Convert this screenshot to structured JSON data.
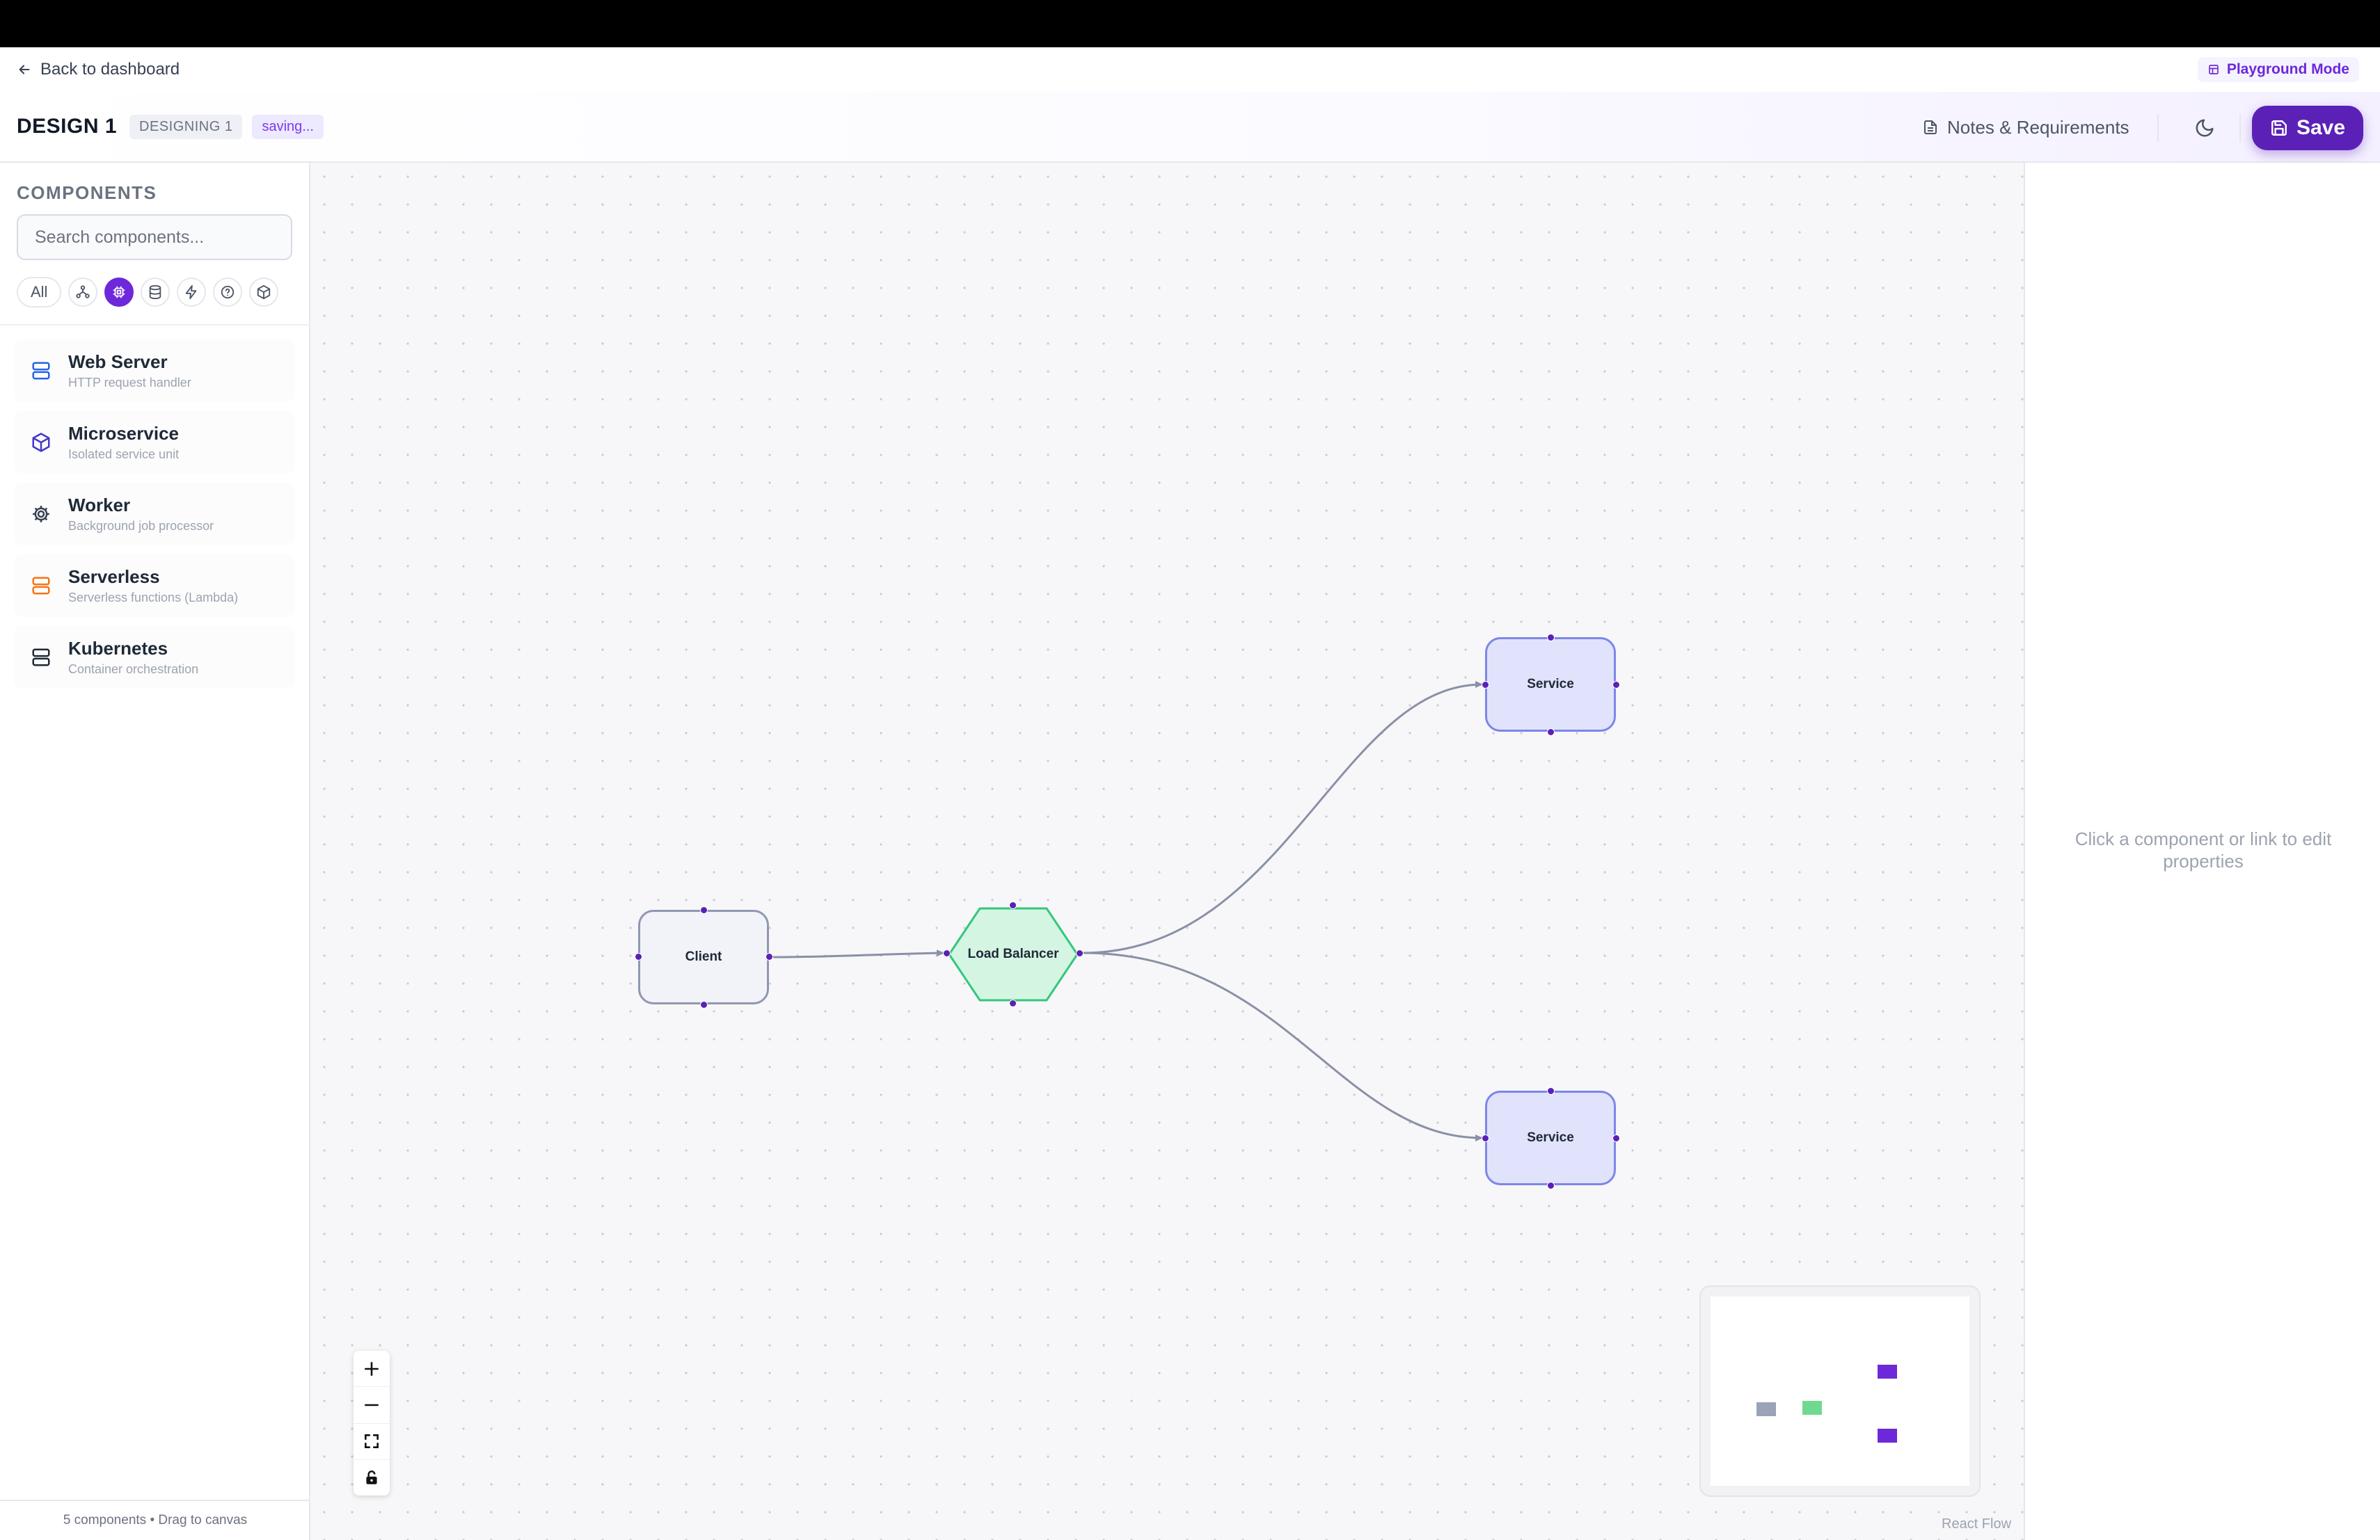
{
  "topbar": {
    "back_label": "Back to dashboard",
    "mode_label": "Playground Mode"
  },
  "header": {
    "title": "DESIGN 1",
    "badge": "DESIGNING 1",
    "status": "saving...",
    "notes_label": "Notes & Requirements",
    "save_label": "Save"
  },
  "sidebar": {
    "heading": "COMPONENTS",
    "search_placeholder": "Search components...",
    "filter_all": "All",
    "filters": [
      "network",
      "compute",
      "storage",
      "messaging",
      "other",
      "package"
    ],
    "active_filter": "compute",
    "components": [
      {
        "name": "Web Server",
        "desc": "HTTP request handler",
        "icon": "server-icon",
        "color": "#2563eb"
      },
      {
        "name": "Microservice",
        "desc": "Isolated service unit",
        "icon": "cube-icon",
        "color": "#4338ca"
      },
      {
        "name": "Worker",
        "desc": "Background job processor",
        "icon": "gear-icon",
        "color": "#374151"
      },
      {
        "name": "Serverless",
        "desc": "Serverless functions (Lambda)",
        "icon": "server-icon",
        "color": "#f97316"
      },
      {
        "name": "Kubernetes",
        "desc": "Container orchestration",
        "icon": "server-icon",
        "color": "#1f2937"
      }
    ],
    "footer": "5 components • Drag to canvas"
  },
  "canvas": {
    "nodes": {
      "client": "Client",
      "load_balancer": "Load Balancer",
      "service_1": "Service",
      "service_2": "Service"
    },
    "attribution": "React Flow"
  },
  "properties": {
    "hint": "Click a component or link to edit properties"
  },
  "colors": {
    "accent": "#5b21b6",
    "client_fill": "#f1f3f8",
    "service_fill": "#e0e3fb",
    "lb_fill": "#d5f5e3",
    "lb_stroke": "#34c77b"
  }
}
